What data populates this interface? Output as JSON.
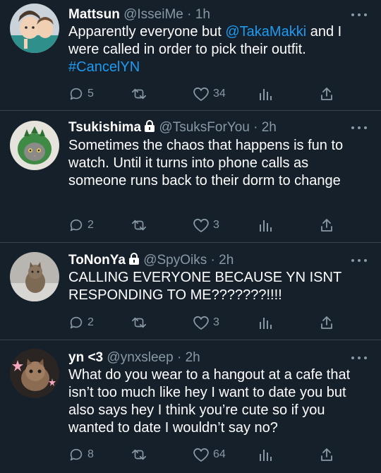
{
  "colors": {
    "background": "#15202b",
    "divider": "#38444d",
    "secondary_text": "#8899a6",
    "link": "#1d9bf0"
  },
  "tweets": [
    {
      "name": "Mattsun",
      "handle": "@IsseiMe",
      "sep": " · ",
      "time": "1h",
      "locked": false,
      "text_before": "Apparently everyone but ",
      "mention": "@TakaMakki",
      "text_after": " and I were called in order to pick their outfit. ",
      "hashtag": "#CancelYN",
      "replies": "5",
      "retweets": "",
      "likes": "34",
      "avatar_icon": "anime-character-avatar"
    },
    {
      "name": "Tsukishima",
      "handle": "@TsuksForYou",
      "sep": " · ",
      "time": "2h",
      "locked": true,
      "text": "Sometimes the chaos that happens is fun to watch. Until it turns into phone calls as someone runs back to their dorm to change",
      "replies": "2",
      "retweets": "",
      "likes": "3",
      "avatar_icon": "cat-in-dino-hood-avatar"
    },
    {
      "name": "ToNonYa",
      "handle": "@SpyOiks",
      "sep": " · ",
      "time": "2h",
      "locked": true,
      "text": "CALLING EVERYONE BECAUSE YN ISNT RESPONDING TO ME???????!!!!",
      "replies": "2",
      "retweets": "",
      "likes": "3",
      "avatar_icon": "cat-photo-avatar"
    },
    {
      "name": "yn <3",
      "handle": "@ynxsleep",
      "sep": " · ",
      "time": "2h",
      "locked": false,
      "text": "What do you wear to a hangout at a cafe that isn’t too much like hey I want to date you but also says hey I think you’re cute so if you wanted to date I wouldn’t say no?",
      "replies": "8",
      "retweets": "",
      "likes": "64",
      "avatar_icon": "kitten-with-stars-avatar"
    }
  ]
}
